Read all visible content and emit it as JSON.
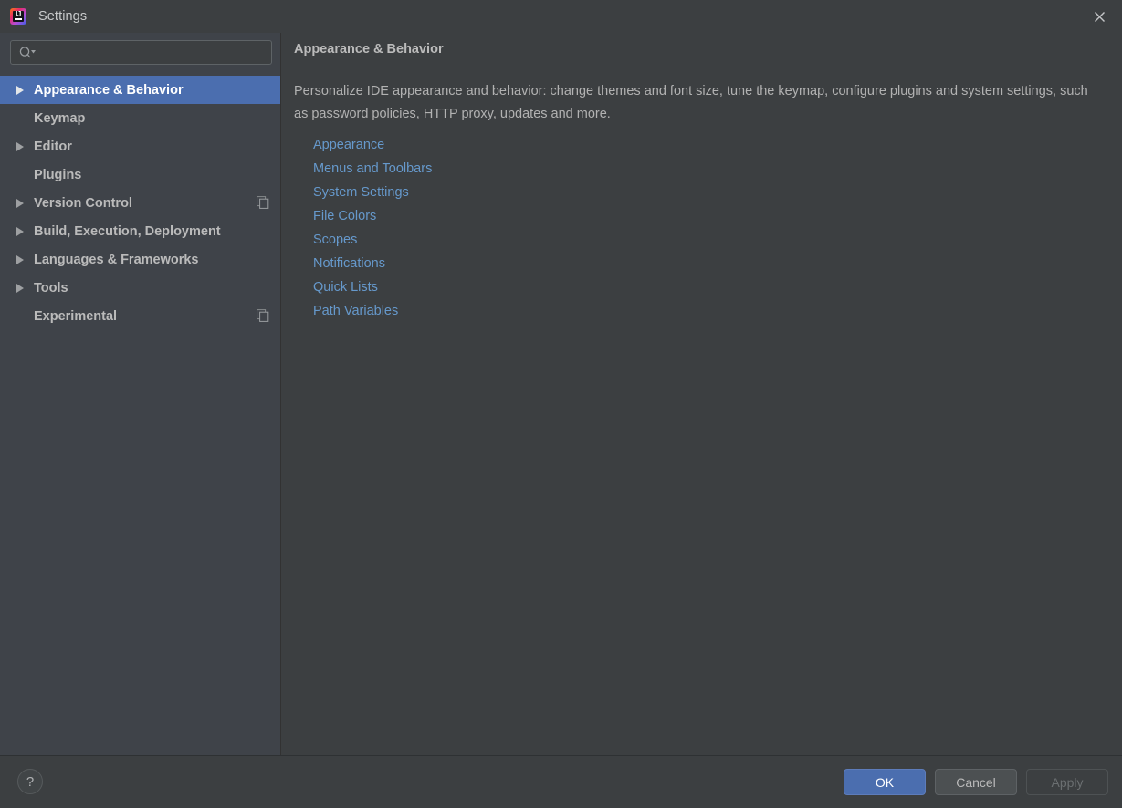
{
  "window": {
    "title": "Settings",
    "app_icon": "intellij-idea-logo",
    "close_icon": "close-icon"
  },
  "search": {
    "value": "",
    "placeholder": "",
    "icon": "search-icon"
  },
  "sidebar": {
    "items": [
      {
        "label": "Appearance & Behavior",
        "expandable": true,
        "selected": true,
        "sync_icon": false
      },
      {
        "label": "Keymap",
        "expandable": false,
        "selected": false,
        "sync_icon": false
      },
      {
        "label": "Editor",
        "expandable": true,
        "selected": false,
        "sync_icon": false
      },
      {
        "label": "Plugins",
        "expandable": false,
        "selected": false,
        "sync_icon": false
      },
      {
        "label": "Version Control",
        "expandable": true,
        "selected": false,
        "sync_icon": true
      },
      {
        "label": "Build, Execution, Deployment",
        "expandable": true,
        "selected": false,
        "sync_icon": false
      },
      {
        "label": "Languages & Frameworks",
        "expandable": true,
        "selected": false,
        "sync_icon": false
      },
      {
        "label": "Tools",
        "expandable": true,
        "selected": false,
        "sync_icon": false
      },
      {
        "label": "Experimental",
        "expandable": false,
        "selected": false,
        "sync_icon": true
      }
    ]
  },
  "content": {
    "title": "Appearance & Behavior",
    "description": "Personalize IDE appearance and behavior: change themes and font size, tune the keymap, configure plugins and system settings, such as password policies, HTTP proxy, updates and more.",
    "links": [
      "Appearance",
      "Menus and Toolbars",
      "System Settings",
      "File Colors",
      "Scopes",
      "Notifications",
      "Quick Lists",
      "Path Variables"
    ]
  },
  "footer": {
    "help_label": "?",
    "ok_label": "OK",
    "cancel_label": "Cancel",
    "apply_label": "Apply",
    "apply_enabled": false
  },
  "colors": {
    "window_bg": "#3c3f41",
    "sidebar_bg": "#3f4349",
    "selection_blue": "#4b6eaf",
    "link_blue": "#6699cc",
    "text": "#bbbbbb",
    "border": "#5e6366"
  }
}
